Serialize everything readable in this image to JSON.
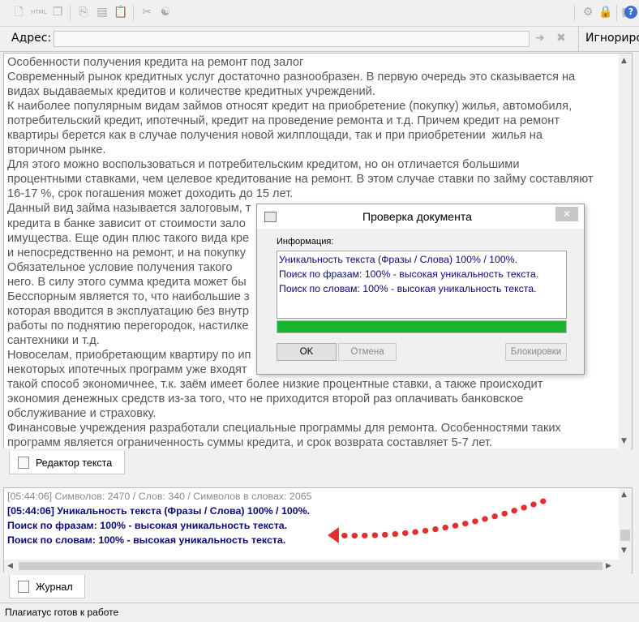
{
  "toolbar": {
    "left_icons": [
      "new-doc-icon",
      "html-icon",
      "copy-doc-icon",
      "copy-icon",
      "paste-doc-icon",
      "paste-icon",
      "tools-icon",
      "yin-yang-icon"
    ],
    "right_icons": [
      "gear-icon",
      "lock-icon",
      "bookmark-icon",
      "help-icon"
    ],
    "help_glyph": "?"
  },
  "address": {
    "label": "Адрес:",
    "value": "",
    "ignore_label": "Игнориро"
  },
  "editor": {
    "lines": [
      "Особенности получения кредита на ремонт под залог",
      "Современный рынок кредитных услуг достаточно разнообразен. В первую очередь это сказывается на",
      "видах выдаваемых кредитов и количестве кредитных учреждений.",
      "К наиболее популярным видам займов относят кредит на приобретение (покупку) жилья, автомобиля,",
      "потребительский кредит, ипотечный, кредит на проведение ремонта и т.д. Причем кредит на ремонт",
      "квартиры берется как в случае получения новой жилплощади, так и при приобретении  жилья на",
      "вторичном рынке.",
      "Для этого можно воспользоваться и потребительским кредитом, но он отличается большими",
      "процентными ставками, чем целевое кредитование на ремонт. В этом случае ставки по займу составляют",
      "16-17 %, срок погашения может доходить до 15 лет.",
      "Данный вид займа называется залоговым, т",
      "кредита в банке зависит от стоимости зало",
      "имущества. Еще один плюс такого вида кре                                                                                  редств",
      "и непосредственно на ремонт, и на покупку",
      "Обязательное условие получения такого                                                                                     на",
      "него. В силу этого сумма кредита может бы",
      "Бесспорным является то, что наибольшие з                                                                                  ир,",
      "которая вводится в эксплуатацию без внутр                                                                                 бя",
      "работы по поднятию перегородок, настилке                                                                                  ",
      "сантехники и т.д.",
      "Новоселам, приобретающим квартиру по ип",
      "некоторых ипотечных программ уже входят                                                                                  то",
      "такой способ экономичнее, т.к. заём имеет более низкие процентные ставки, а также происходит",
      "экономия денежных средств из-за того, что не приходится второй раз оплачивать банковское",
      "обслуживание и страховку.",
      "Финансовые учреждения разработали специальные программы для ремонта. Особенностями таких",
      "программ является ограниченность суммы кредита, и срок возврата составляет 5-7 лет."
    ]
  },
  "tabs": {
    "editor_tab": "Редактор текста",
    "journal_tab": "Журнал"
  },
  "log": {
    "stats_line": "[05:44:06] Символов: 2470 / Слов: 340 / Символов в словах: 2065",
    "line1": "[05:44:06] Уникальность текста (Фразы / Слова) 100% / 100%.",
    "line2": "Поиск по фразам: 100% - высокая уникальность текста.",
    "line3": "Поиск по словам: 100% - высокая уникальность текста."
  },
  "status": {
    "text": "Плагиатус готов к работе"
  },
  "dialog": {
    "title": "Проверка документа",
    "close_glyph": "✕",
    "info_label": "Информация:",
    "lines": [
      "Уникальность текста (Фразы / Слова) 100% / 100%.",
      "Поиск по фразам: 100% - высокая уникальность текста.",
      "Поиск по словам: 100% - высокая уникальность текста."
    ],
    "progress": 1.0,
    "ok_label": "OK",
    "cancel_label": "Отмена",
    "block_label": "Блокировки"
  },
  "colors": {
    "log_stats": "#8a8a8a",
    "log_text": "#0a0a78",
    "arrow": "#e23030",
    "progress": "#18b330"
  }
}
